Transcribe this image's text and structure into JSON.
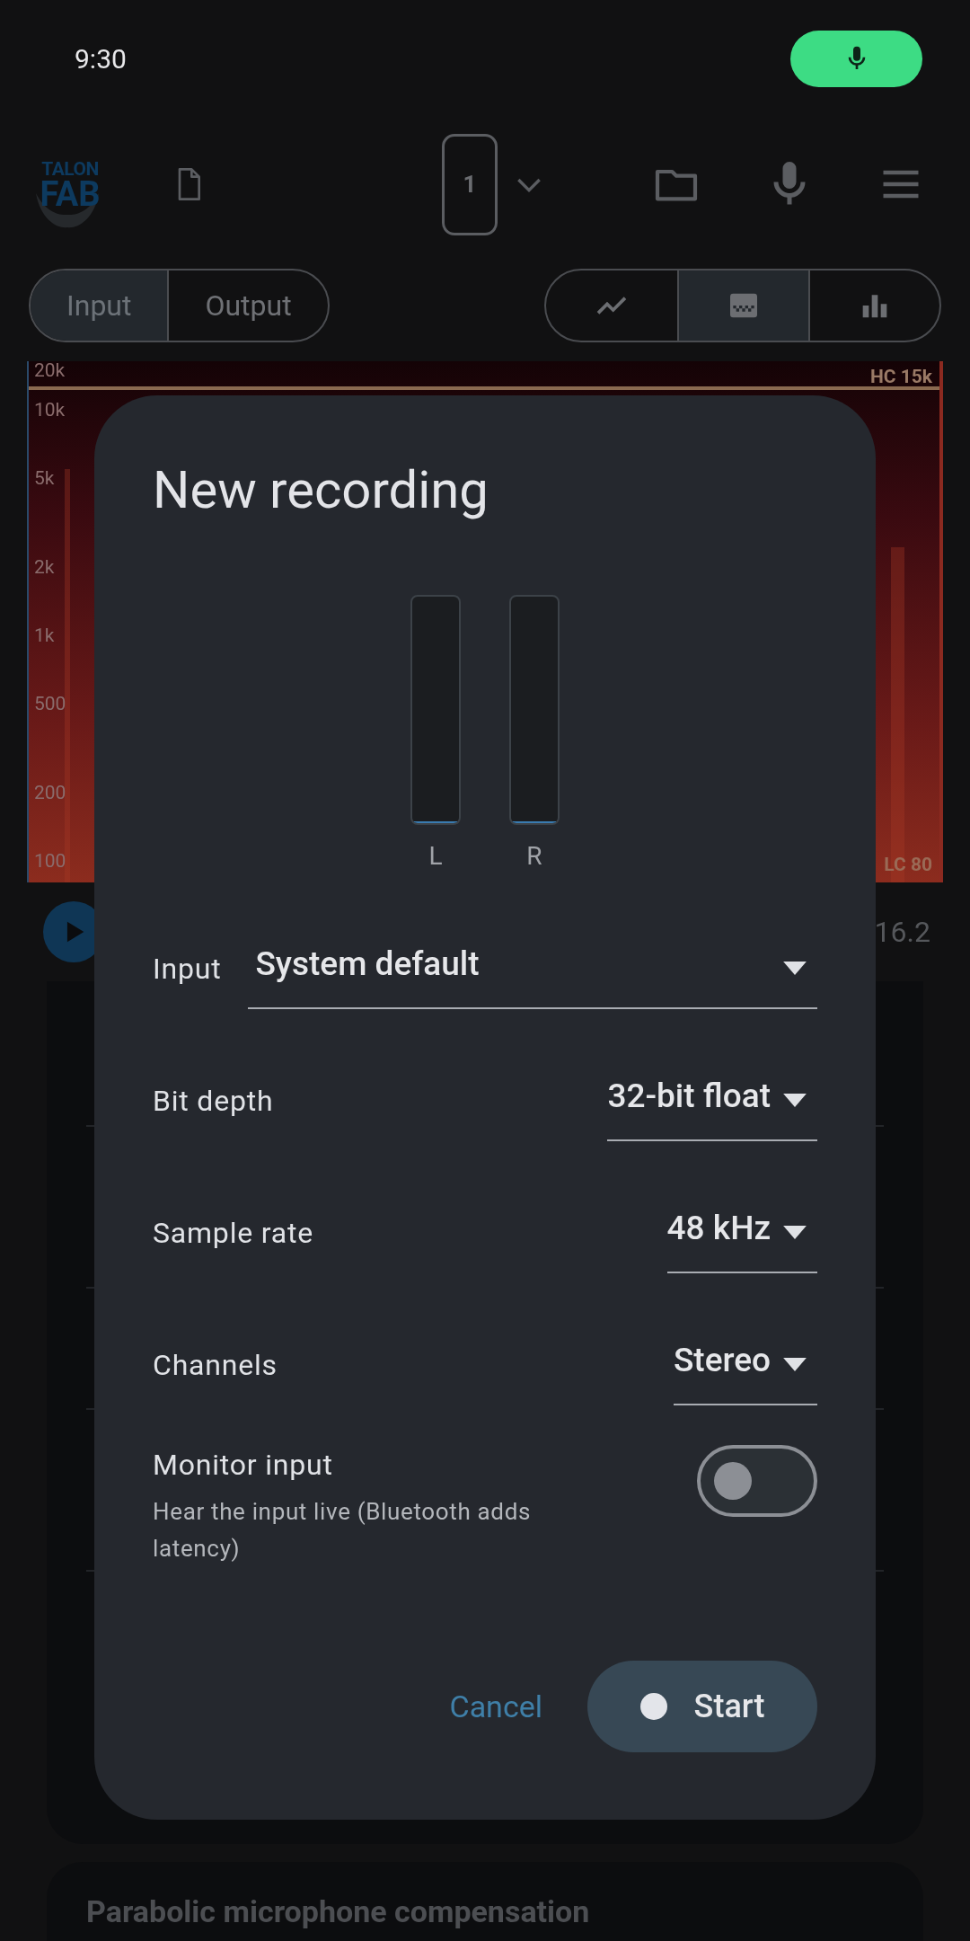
{
  "status_bar": {
    "time": "9:30",
    "mic_active": true
  },
  "toolbar": {
    "logo": [
      "TALON",
      "FAB"
    ],
    "channel": "1"
  },
  "source_tabs": [
    {
      "label": "Input",
      "selected": true
    },
    {
      "label": "Output",
      "selected": false
    }
  ],
  "view_tabs": [
    {
      "kind": "line",
      "selected": false
    },
    {
      "kind": "spectrogram",
      "selected": true
    },
    {
      "kind": "bars",
      "selected": false
    }
  ],
  "spectrogram": {
    "freq_labels": [
      "20k",
      "10k",
      "5k",
      "2k",
      "1k",
      "500",
      "200",
      "100"
    ],
    "high_cut": "HC 15k",
    "low_cut": "LC 80"
  },
  "player": {
    "time": "16.2"
  },
  "next_card": {
    "title": "Parabolic microphone compensation"
  },
  "dialog": {
    "title": "New recording",
    "meters": [
      {
        "label": "L",
        "level": 0
      },
      {
        "label": "R",
        "level": 0
      }
    ],
    "fields": [
      {
        "label": "Input",
        "value": "System default",
        "kind": "full"
      },
      {
        "label": "Bit depth",
        "value": "32-bit float",
        "kind": "inline"
      },
      {
        "label": "Sample rate",
        "value": "48 kHz",
        "kind": "inline"
      },
      {
        "label": "Channels",
        "value": "Stereo",
        "kind": "inline"
      }
    ],
    "monitor": {
      "label": "Monitor input",
      "hint": "Hear the input live (Bluetooth adds latency)",
      "on": false
    },
    "cancel": "Cancel",
    "start": "Start"
  }
}
